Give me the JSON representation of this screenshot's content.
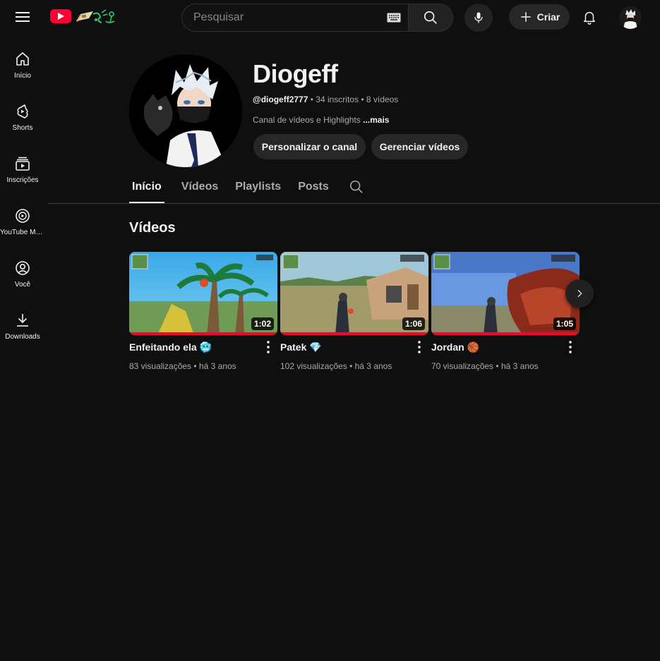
{
  "topbar": {
    "search_placeholder": "Pesquisar",
    "create_label": "Criar"
  },
  "sidebar": {
    "items": [
      {
        "label": "Início",
        "icon": "home-icon"
      },
      {
        "label": "Shorts",
        "icon": "shorts-icon"
      },
      {
        "label": "Inscrições",
        "icon": "subscriptions-icon"
      },
      {
        "label": "YouTube Music",
        "icon": "youtube-music-icon"
      },
      {
        "label": "Você",
        "icon": "you-icon"
      },
      {
        "label": "Downloads",
        "icon": "download-icon"
      }
    ]
  },
  "channel": {
    "name": "Diogeff",
    "handle": "@diogeff2777",
    "subscribers": "34 inscritos",
    "video_count": "8 vídeos",
    "description": "Canal de vídeos e Highlights",
    "more_label": "...mais",
    "customize_label": "Personalizar o canal",
    "manage_label": "Gerenciar vídeos"
  },
  "tabs": [
    {
      "label": "Início",
      "active": true
    },
    {
      "label": "Vídeos",
      "active": false
    },
    {
      "label": "Playlists",
      "active": false
    },
    {
      "label": "Posts",
      "active": false
    }
  ],
  "videos_section": {
    "title": "Vídeos",
    "items": [
      {
        "title": "Enfeitando ela 🥶",
        "views": "83 visualizações",
        "age": "há 3 anos",
        "duration": "1:02"
      },
      {
        "title": "Patek 💎",
        "views": "102 visualizações",
        "age": "há 3 anos",
        "duration": "1:06"
      },
      {
        "title": "Jordan 🏀",
        "views": "70 visualizações",
        "age": "há 3 anos",
        "duration": "1:05"
      }
    ]
  },
  "colors": {
    "background": "#0f0f0f",
    "brand_red": "#ff0033",
    "pill": "#272727",
    "text_secondary": "#aaaaaa"
  }
}
